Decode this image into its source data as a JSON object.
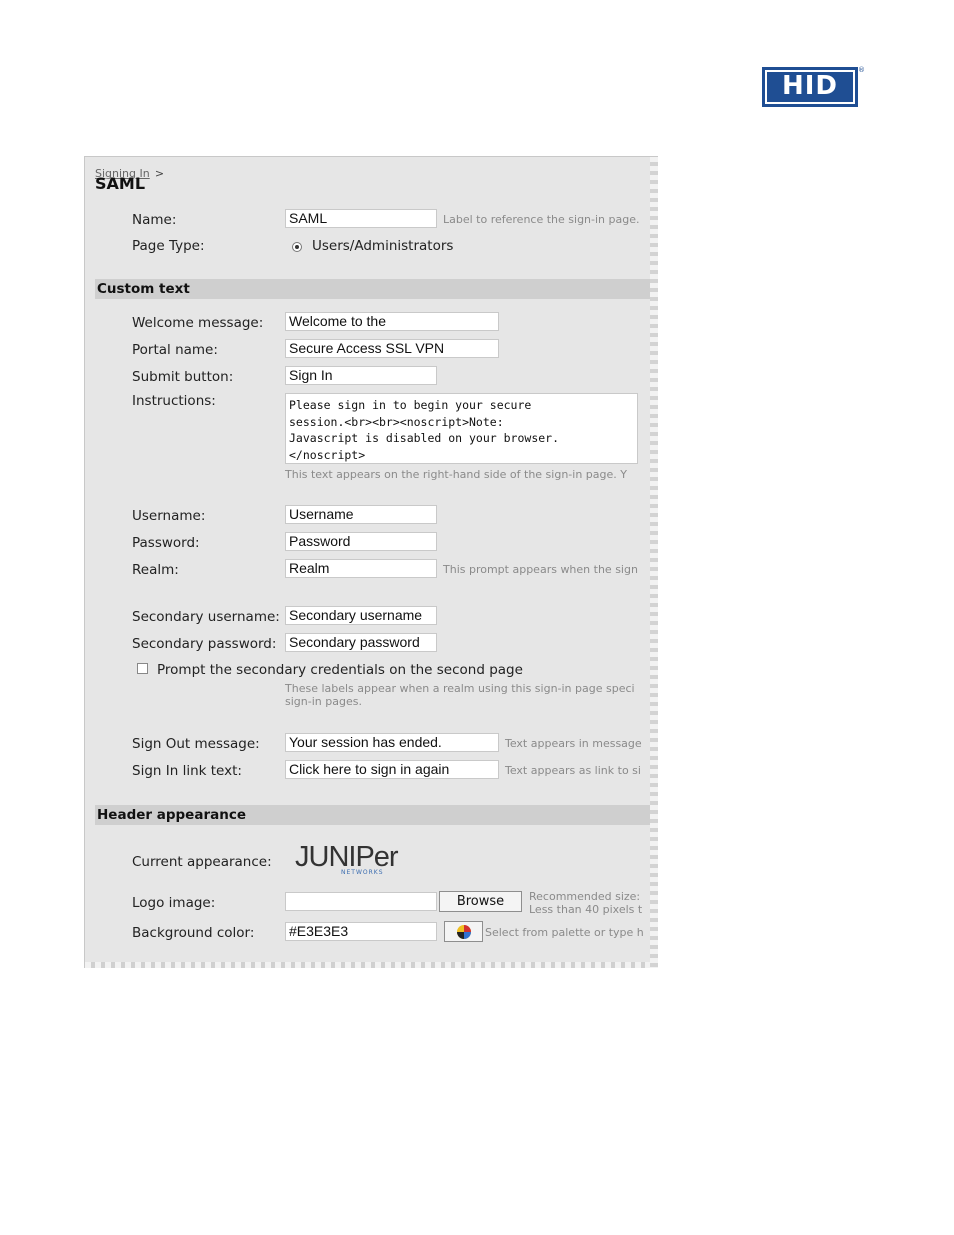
{
  "brand": {
    "logo_text": "HID",
    "registered_mark": "®"
  },
  "breadcrumb": {
    "link": "Signing In",
    "separator": ">"
  },
  "page_title": "SAML",
  "form": {
    "name": {
      "label": "Name:",
      "value": "SAML",
      "hint": "Label to reference the sign-in page."
    },
    "page_type": {
      "label": "Page Type:",
      "option": "Users/Administrators"
    }
  },
  "custom_text": {
    "header": "Custom text",
    "welcome": {
      "label": "Welcome message:",
      "value": "Welcome to the"
    },
    "portal": {
      "label": "Portal name:",
      "value": "Secure Access SSL VPN"
    },
    "submit": {
      "label": "Submit button:",
      "value": "Sign In"
    },
    "instructions": {
      "label": "Instructions:",
      "value": "Please sign in to begin your secure\nsession.<br><br><noscript>Note:\nJavascript is disabled on your browser.\n</noscript>",
      "hint": "This text appears on the right-hand side of the sign-in page. Y"
    },
    "username": {
      "label": "Username:",
      "value": "Username"
    },
    "password": {
      "label": "Password:",
      "value": "Password"
    },
    "realm": {
      "label": "Realm:",
      "value": "Realm",
      "hint": "This prompt appears when the sign"
    },
    "secondary_username": {
      "label": "Secondary username:",
      "value": "Secondary username"
    },
    "secondary_password": {
      "label": "Secondary password:",
      "value": "Secondary password"
    },
    "prompt_secondary": {
      "label": "Prompt the secondary credentials on the second page",
      "checked": false
    },
    "secondary_hint_line1": "These labels appear when a realm using this sign-in page speci",
    "secondary_hint_line2": "sign-in pages.",
    "signout": {
      "label": "Sign Out message:",
      "value": "Your session has ended.",
      "hint": "Text appears in message"
    },
    "signin_link": {
      "label": "Sign In link text:",
      "value": "Click here to sign in again",
      "hint": "Text appears as link to si"
    }
  },
  "header_appearance": {
    "header": "Header appearance",
    "current": {
      "label": "Current appearance:",
      "logo_text": "JUNIPer",
      "logo_subtext": "NETWORKS"
    },
    "logo_image": {
      "label": "Logo image:",
      "value": "",
      "browse_label": "Browse",
      "hint_line1": "Recommended size:",
      "hint_line2": "Less than 40 pixels t"
    },
    "background_color": {
      "label": "Background color:",
      "value": "#E3E3E3",
      "hint": "Select from palette or type h"
    }
  },
  "colors": {
    "hid_blue": "#1f4e93",
    "section_bar": "#cfcfcf",
    "panel_bg": "#e6e6e6"
  }
}
